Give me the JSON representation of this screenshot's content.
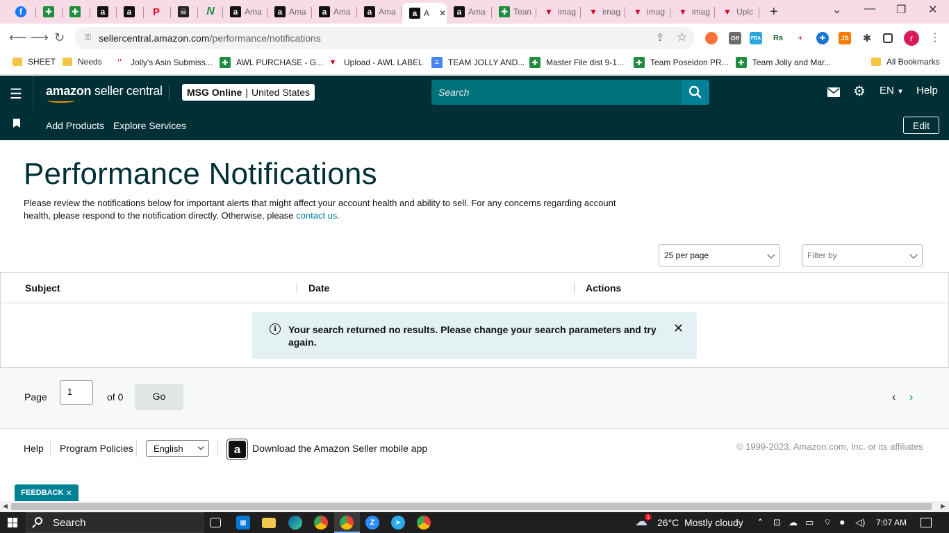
{
  "browser": {
    "tabs": [
      {
        "label": "",
        "icon": "facebook-icon",
        "kind": "fb"
      },
      {
        "label": "",
        "icon": "google-sheets-icon",
        "kind": "sheet"
      },
      {
        "label": "",
        "icon": "google-sheets-icon",
        "kind": "sheet"
      },
      {
        "label": "",
        "icon": "amazon-icon",
        "kind": "amz"
      },
      {
        "label": "",
        "icon": "amazon-icon",
        "kind": "amz"
      },
      {
        "label": "",
        "icon": "pinterest-icon",
        "kind": "pin"
      },
      {
        "label": "",
        "icon": "skull-icon",
        "kind": "skull"
      },
      {
        "label": "",
        "icon": "n-logo-icon",
        "kind": "n"
      },
      {
        "label": "Ama",
        "icon": "amazon-icon",
        "kind": "amz"
      },
      {
        "label": "Ama",
        "icon": "amazon-icon",
        "kind": "amz"
      },
      {
        "label": "Ama",
        "icon": "amazon-icon",
        "kind": "amz"
      },
      {
        "label": "Ama",
        "icon": "amazon-icon",
        "kind": "amz"
      },
      {
        "label": "A",
        "icon": "amazon-icon",
        "kind": "amz",
        "active": true
      },
      {
        "label": "Ama",
        "icon": "amazon-icon",
        "kind": "amz"
      },
      {
        "label": "Tean",
        "icon": "google-sheets-icon",
        "kind": "sheet"
      },
      {
        "label": "imag",
        "icon": "triangle-logo-icon",
        "kind": "tri"
      },
      {
        "label": "imag",
        "icon": "triangle-logo-icon",
        "kind": "tri"
      },
      {
        "label": "imag",
        "icon": "triangle-logo-icon",
        "kind": "tri"
      },
      {
        "label": "imag",
        "icon": "triangle-logo-icon",
        "kind": "tri"
      },
      {
        "label": "Uplc",
        "icon": "triangle-logo-icon",
        "kind": "tri"
      }
    ],
    "url_host": "sellercentral.amazon.com",
    "url_path": "/performance/notifications",
    "profile_initial": "r",
    "bookmarks": [
      {
        "label": "SHEET",
        "icon": "folder"
      },
      {
        "label": "Needs",
        "icon": "folder"
      },
      {
        "label": "Jolly's Asin Submiss...",
        "icon": "fig"
      },
      {
        "label": "AWL PURCHASE - G...",
        "icon": "sheet"
      },
      {
        "label": "Upload - AWL LABEL",
        "icon": "tri"
      },
      {
        "label": "TEAM JOLLY AND...",
        "icon": "doc"
      },
      {
        "label": "Master File dist 9-1...",
        "icon": "sheet"
      },
      {
        "label": "Team Poseidon PR...",
        "icon": "sheet"
      },
      {
        "label": "Team Jolly and Mar...",
        "icon": "sheet"
      }
    ],
    "all_bookmarks": "All Bookmarks"
  },
  "header": {
    "logo_bold": "amazon",
    "logo_light": " seller central",
    "store_name": "MSG Online",
    "store_sep": "|",
    "store_region": "United States",
    "search_placeholder": "Search",
    "language": "EN",
    "help": "Help"
  },
  "subnav": {
    "links": [
      "Add Products",
      "Explore Services"
    ],
    "edit": "Edit"
  },
  "main": {
    "title": "Performance Notifications",
    "intro": "Please review the notifications below for important alerts that might affect your account health and ability to sell. For any concerns regarding account health, please respond to the notification directly. Otherwise, please ",
    "contact_link": "contact us.",
    "per_page": "25 per page",
    "filter": "Filter by",
    "columns": [
      "Subject",
      "Date",
      "Actions"
    ],
    "empty_message": "Your search returned no results. Please change your search parameters and try again."
  },
  "pager": {
    "page_label": "Page",
    "page_value": "1",
    "of_label": "of 0",
    "go": "Go"
  },
  "footer": {
    "help": "Help",
    "policies": "Program Policies",
    "language": "English",
    "app_text": "Download the Amazon Seller mobile app",
    "copyright": "© 1999-2023, Amazon.com, Inc. or its affiliates",
    "feedback": "FEEDBACK"
  },
  "taskbar": {
    "search": "Search",
    "weather_temp": "26°C",
    "weather_desc": "Mostly cloudy",
    "weather_badge": "1",
    "time": "7:07 AM"
  },
  "colors": {
    "header_bg": "#002f36",
    "accent": "#008296",
    "alert_bg": "#e4f1f2"
  }
}
